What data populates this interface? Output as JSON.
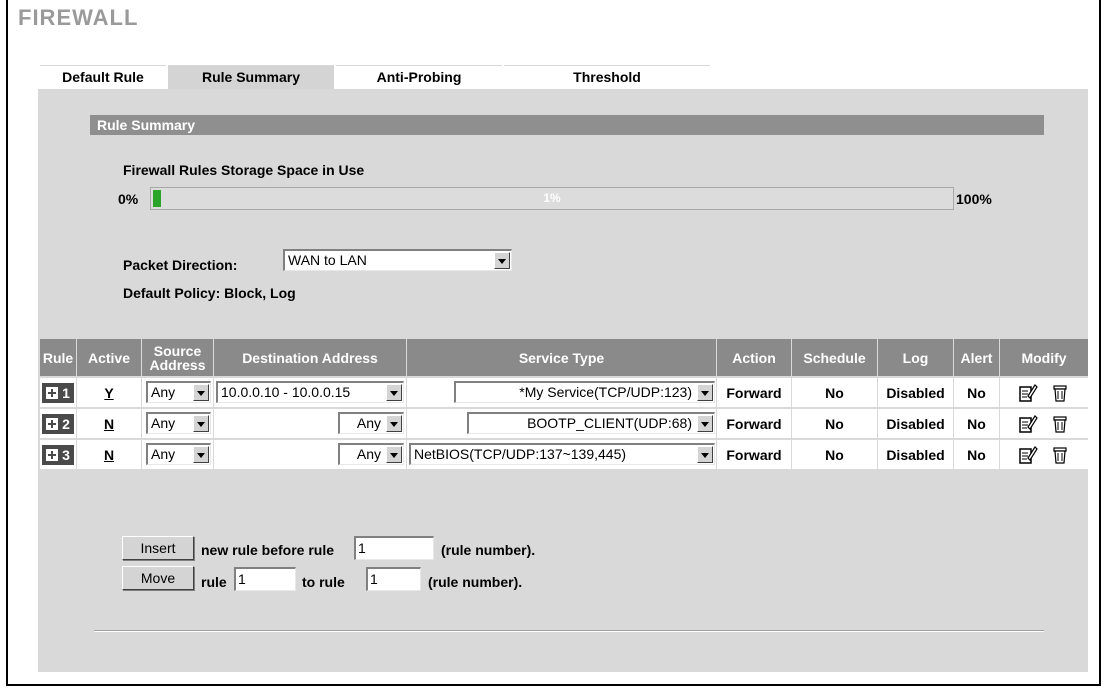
{
  "page": {
    "title": "FIREWALL"
  },
  "tabs": [
    {
      "label": "Default Rule",
      "active": false
    },
    {
      "label": "Rule Summary",
      "active": true
    },
    {
      "label": "Anti-Probing",
      "active": false
    },
    {
      "label": "Threshold",
      "active": false
    }
  ],
  "summary": {
    "section_title": "Rule Summary",
    "storage_label": "Firewall Rules Storage Space in Use",
    "min_label": "0%",
    "max_label": "100%",
    "usage_text": "1%",
    "usage_percent": 1,
    "direction_label": "Packet Direction:",
    "direction_value": "WAN to LAN",
    "default_policy": "Default Policy: Block, Log"
  },
  "table": {
    "headers": {
      "rule": "Rule",
      "active": "Active",
      "source": "Source Address",
      "destination": "Destination Address",
      "service": "Service Type",
      "action": "Action",
      "schedule": "Schedule",
      "log": "Log",
      "alert": "Alert",
      "modify": "Modify"
    },
    "rows": [
      {
        "rule": "1",
        "active": "Y",
        "source": "Any",
        "destination": "10.0.0.10 - 10.0.0.15",
        "service": "*My Service(TCP/UDP:123)",
        "action": "Forward",
        "schedule": "No",
        "log": "Disabled",
        "alert": "No"
      },
      {
        "rule": "2",
        "active": "N",
        "source": "Any",
        "destination": "Any",
        "service": "BOOTP_CLIENT(UDP:68)",
        "action": "Forward",
        "schedule": "No",
        "log": "Disabled",
        "alert": "No"
      },
      {
        "rule": "3",
        "active": "N",
        "source": "Any",
        "destination": "Any",
        "service": "NetBIOS(TCP/UDP:137~139,445)",
        "action": "Forward",
        "schedule": "No",
        "log": "Disabled",
        "alert": "No"
      }
    ]
  },
  "controls": {
    "insert_label": "Insert",
    "insert_text": "new rule before rule",
    "insert_value": "1",
    "rule_number_text": "(rule number).",
    "move_label": "Move",
    "move_rule_text": "rule",
    "move_from_value": "1",
    "move_to_text": "to rule",
    "move_to_value": "1"
  },
  "icons": {
    "edit": "edit-icon",
    "delete": "trash-icon",
    "expand": "plus-icon"
  },
  "colors": {
    "header_bg": "#8a8a8a",
    "panel_bg": "#d9d9d9",
    "progress_fill": "#2aa52a"
  }
}
